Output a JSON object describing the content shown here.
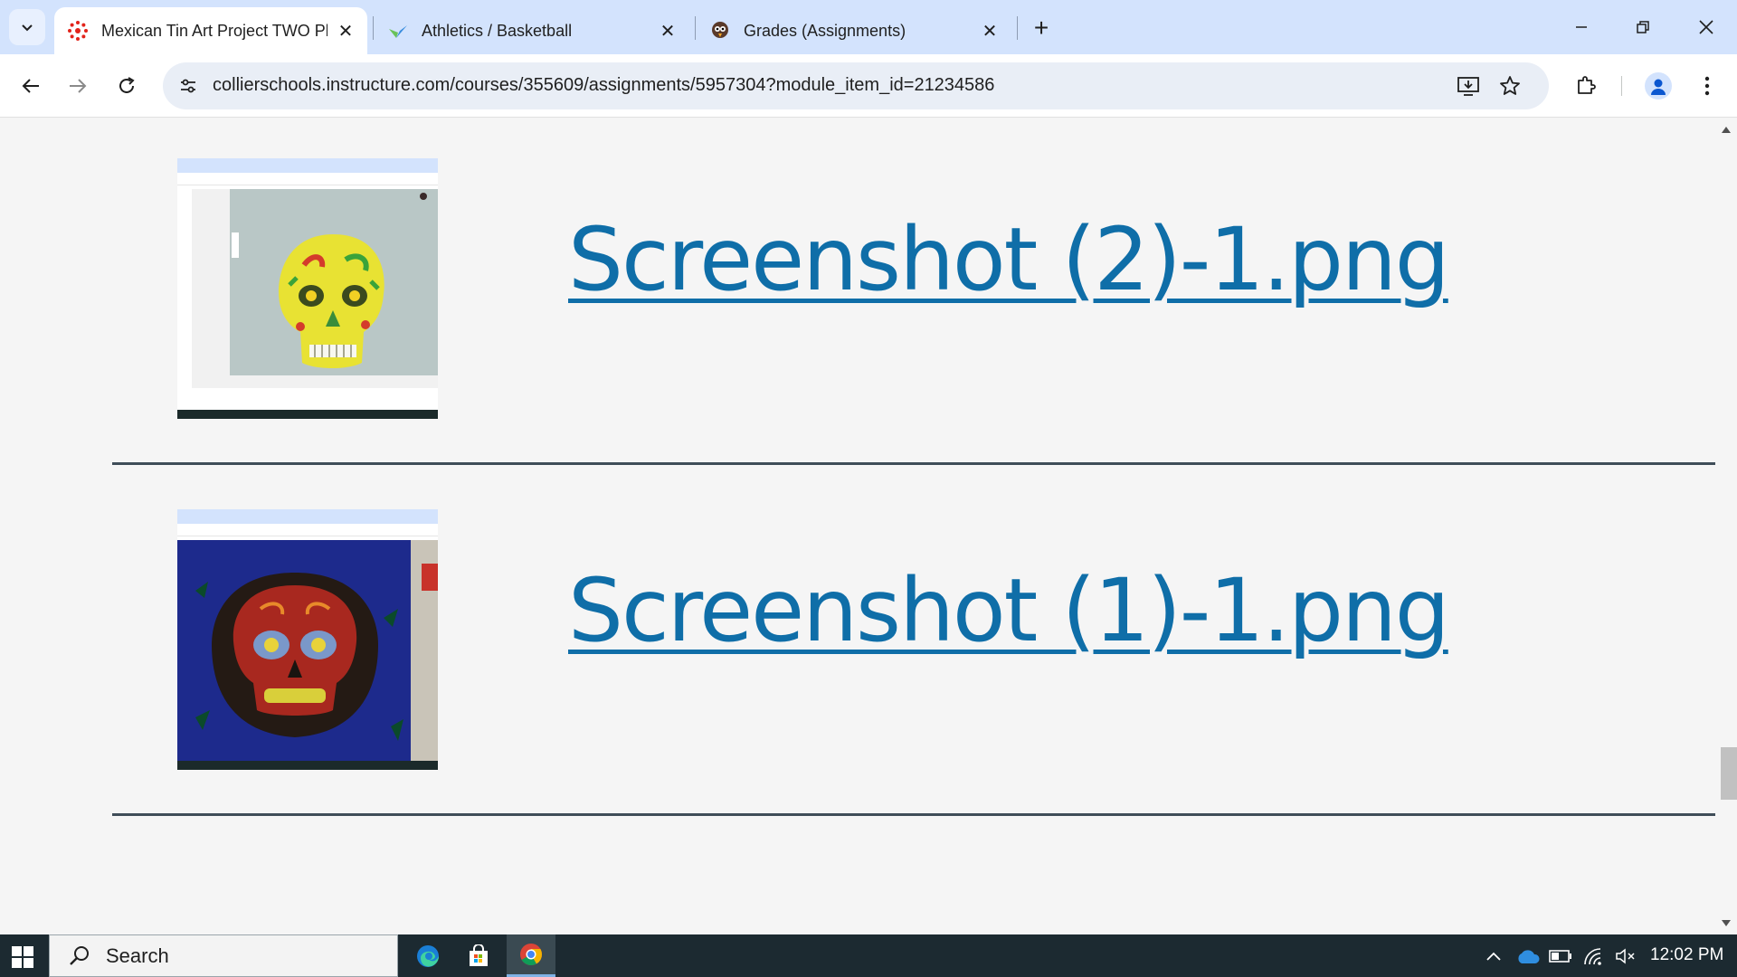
{
  "browser": {
    "tabs": [
      {
        "title": "Mexican Tin Art Project TWO Pl",
        "favicon": "canvas-icon",
        "active": true
      },
      {
        "title": "Athletics / Basketball",
        "favicon": "athletics-icon",
        "active": false
      },
      {
        "title": "Grades (Assignments)",
        "favicon": "grades-icon",
        "active": false
      }
    ],
    "new_tab_label": "+",
    "url": "collierschools.instructure.com/courses/355609/assignments/5957304?module_item_id=21234586"
  },
  "attachments": [
    {
      "link_text": "Screenshot (2)-1.png",
      "thumbnail": "yellow-skull-thumbnail"
    },
    {
      "link_text": "Screenshot (1)-1.png",
      "thumbnail": "dark-skull-thumbnail"
    }
  ],
  "taskbar": {
    "search_label": "Search",
    "time": "12:02 PM"
  },
  "colors": {
    "link": "#0f6ea8",
    "tabstrip": "#d3e3fd",
    "taskbar": "#1c2a31",
    "divider": "#3f4d58"
  }
}
